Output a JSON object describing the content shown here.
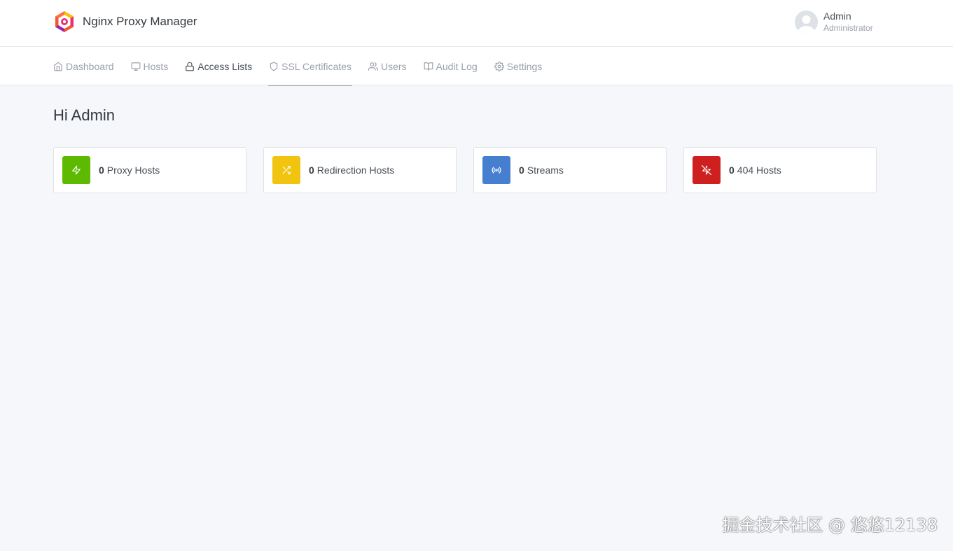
{
  "app": {
    "title": "Nginx Proxy Manager"
  },
  "user": {
    "name": "Admin",
    "role": "Administrator"
  },
  "nav": [
    {
      "label": "Dashboard",
      "icon": "home-icon"
    },
    {
      "label": "Hosts",
      "icon": "monitor-icon"
    },
    {
      "label": "Access Lists",
      "icon": "lock-icon"
    },
    {
      "label": "SSL Certificates",
      "icon": "shield-icon"
    },
    {
      "label": "Users",
      "icon": "users-icon"
    },
    {
      "label": "Audit Log",
      "icon": "book-icon"
    },
    {
      "label": "Settings",
      "icon": "gear-icon"
    }
  ],
  "greeting": "Hi Admin",
  "stats": [
    {
      "count": "0",
      "label": "Proxy Hosts",
      "icon": "zap-icon",
      "color": "#5eba00"
    },
    {
      "count": "0",
      "label": "Redirection Hosts",
      "icon": "shuffle-icon",
      "color": "#f1c40f"
    },
    {
      "count": "0",
      "label": "Streams",
      "icon": "radio-icon",
      "color": "#467fcf"
    },
    {
      "count": "0",
      "label": "404 Hosts",
      "icon": "zap-off-icon",
      "color": "#cd201f"
    }
  ],
  "watermark": "掘金技术社区 @ 悠悠12138"
}
